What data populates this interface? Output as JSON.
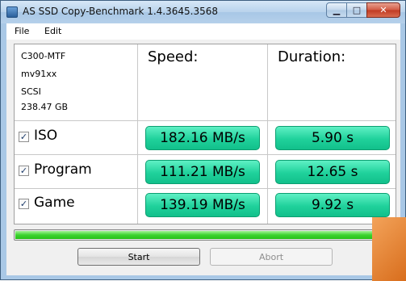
{
  "window": {
    "title": "AS SSD Copy-Benchmark 1.4.3645.3568"
  },
  "menu": {
    "file": "File",
    "edit": "Edit"
  },
  "device": {
    "model": "C300-MTF",
    "controller": "mv91xx",
    "interface": "SCSI",
    "size": "238.47 GB"
  },
  "headers": {
    "speed": "Speed:",
    "duration": "Duration:"
  },
  "rows": [
    {
      "label": "ISO",
      "checked": true,
      "speed": "182.16 MB/s",
      "duration": "5.90 s"
    },
    {
      "label": "Program",
      "checked": true,
      "speed": "111.21 MB/s",
      "duration": "12.65 s"
    },
    {
      "label": "Game",
      "checked": true,
      "speed": "139.19 MB/s",
      "duration": "9.92 s"
    }
  ],
  "progress": {
    "fraction": 1.0
  },
  "buttons": {
    "start": "Start",
    "abort": "Abort"
  },
  "colors": {
    "result_fill": "#1fd19b",
    "progress_fill": "#3dd32f"
  },
  "icons": {
    "check": "✓",
    "minimize": "minimize-icon",
    "maximize": "maximize-icon",
    "close": "close-icon"
  }
}
